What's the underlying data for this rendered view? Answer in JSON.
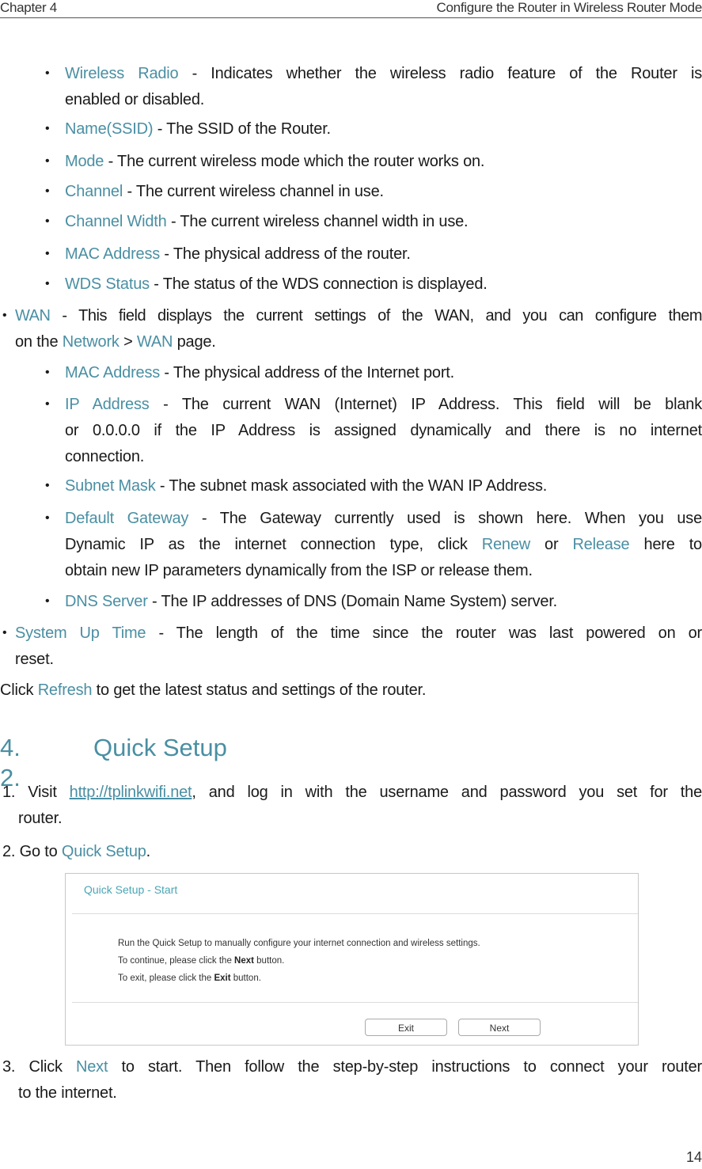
{
  "header": {
    "chapter": "Chapter 4",
    "title": "Configure the Router in Wireless Router Mode"
  },
  "colors": {
    "accent": "#4a8fa3",
    "text": "#1a1a1a",
    "panel_title": "#4aa6b4"
  },
  "wireless_items": [
    {
      "term": "Wireless Radio",
      "desc_line1": " - Indicates whether the wireless radio feature of the Router is",
      "desc_line2": "enabled or disabled."
    },
    {
      "term": "Name(SSID)",
      "desc": " - The SSID of the Router."
    },
    {
      "term": "Mode",
      "desc": " - The current wireless mode which the router works on."
    },
    {
      "term": "Channel",
      "desc": " - The current wireless channel in use."
    },
    {
      "term": "Channel Width",
      "desc": " - The current wireless channel width in use."
    },
    {
      "term": "MAC Address",
      "desc": " - The physical address of the router."
    },
    {
      "term": "WDS Status",
      "desc": " - The status of the WDS connection is displayed."
    }
  ],
  "wan": {
    "term": "WAN",
    "desc_line1": " - This field displays the current settings of the WAN, and you can configure them",
    "line2_prefix": "on the ",
    "nav1": "Network",
    "sep": " > ",
    "nav2": "WAN",
    "line2_suffix": " page.",
    "items": [
      {
        "term": "MAC Address",
        "desc": " - The physical address of the Internet port."
      },
      {
        "term": "IP Address",
        "desc_line1": " - The current WAN (Internet) IP Address. This field will be blank",
        "desc_line2": "or 0.0.0.0 if the IP Address is assigned dynamically and there is no internet",
        "desc_line3": "connection."
      },
      {
        "term": "Subnet Mask",
        "desc": " - The subnet mask associated with the WAN IP Address."
      },
      {
        "term": "Default Gateway",
        "desc_line1": " - The Gateway currently used is shown here. When you use",
        "line2_prefix": "Dynamic IP as the internet connection type, click ",
        "renew": "Renew",
        "or": " or ",
        "release": "Release",
        "line2_suffix": " here to",
        "desc_line3": "obtain new IP parameters dynamically from the ISP or release them."
      },
      {
        "term": "DNS Server",
        "desc": " - The IP addresses of DNS (Domain Name System) server."
      }
    ]
  },
  "uptime": {
    "term": "System Up Time",
    "desc_line1": " - The length of the time since the router was last powered on or",
    "desc_line2": "reset."
  },
  "refresh": {
    "prefix": "Click ",
    "link": "Refresh",
    "suffix": " to get the latest status and settings of the router."
  },
  "section": {
    "number": "4. 2.",
    "title": "Quick Setup"
  },
  "steps": [
    {
      "num": "1. ",
      "prefix": "Visit ",
      "url": "http://tplinkwifi.net",
      "suffix": ", and log in with the username and password you set for the",
      "line2": "router."
    },
    {
      "num": "2. ",
      "prefix": "Go to ",
      "link": "Quick Setup",
      "suffix": "."
    },
    {
      "num": "3. ",
      "prefix": "Click ",
      "link": "Next",
      "suffix": " to start. Then follow the step-by-step instructions to connect your router",
      "line2": "to the internet."
    }
  ],
  "quick_setup_panel": {
    "title": "Quick Setup - Start",
    "line1": "Run the Quick Setup to manually configure your internet connection and wireless settings.",
    "line2_prefix": "To continue, please click the ",
    "line2_bold": "Next",
    "line2_suffix": " button.",
    "line3_prefix": "To exit, please click the ",
    "line3_bold": "Exit",
    "line3_suffix": " button.",
    "exit_button": "Exit",
    "next_button": "Next"
  },
  "page_number": "14",
  "bullet": "•"
}
